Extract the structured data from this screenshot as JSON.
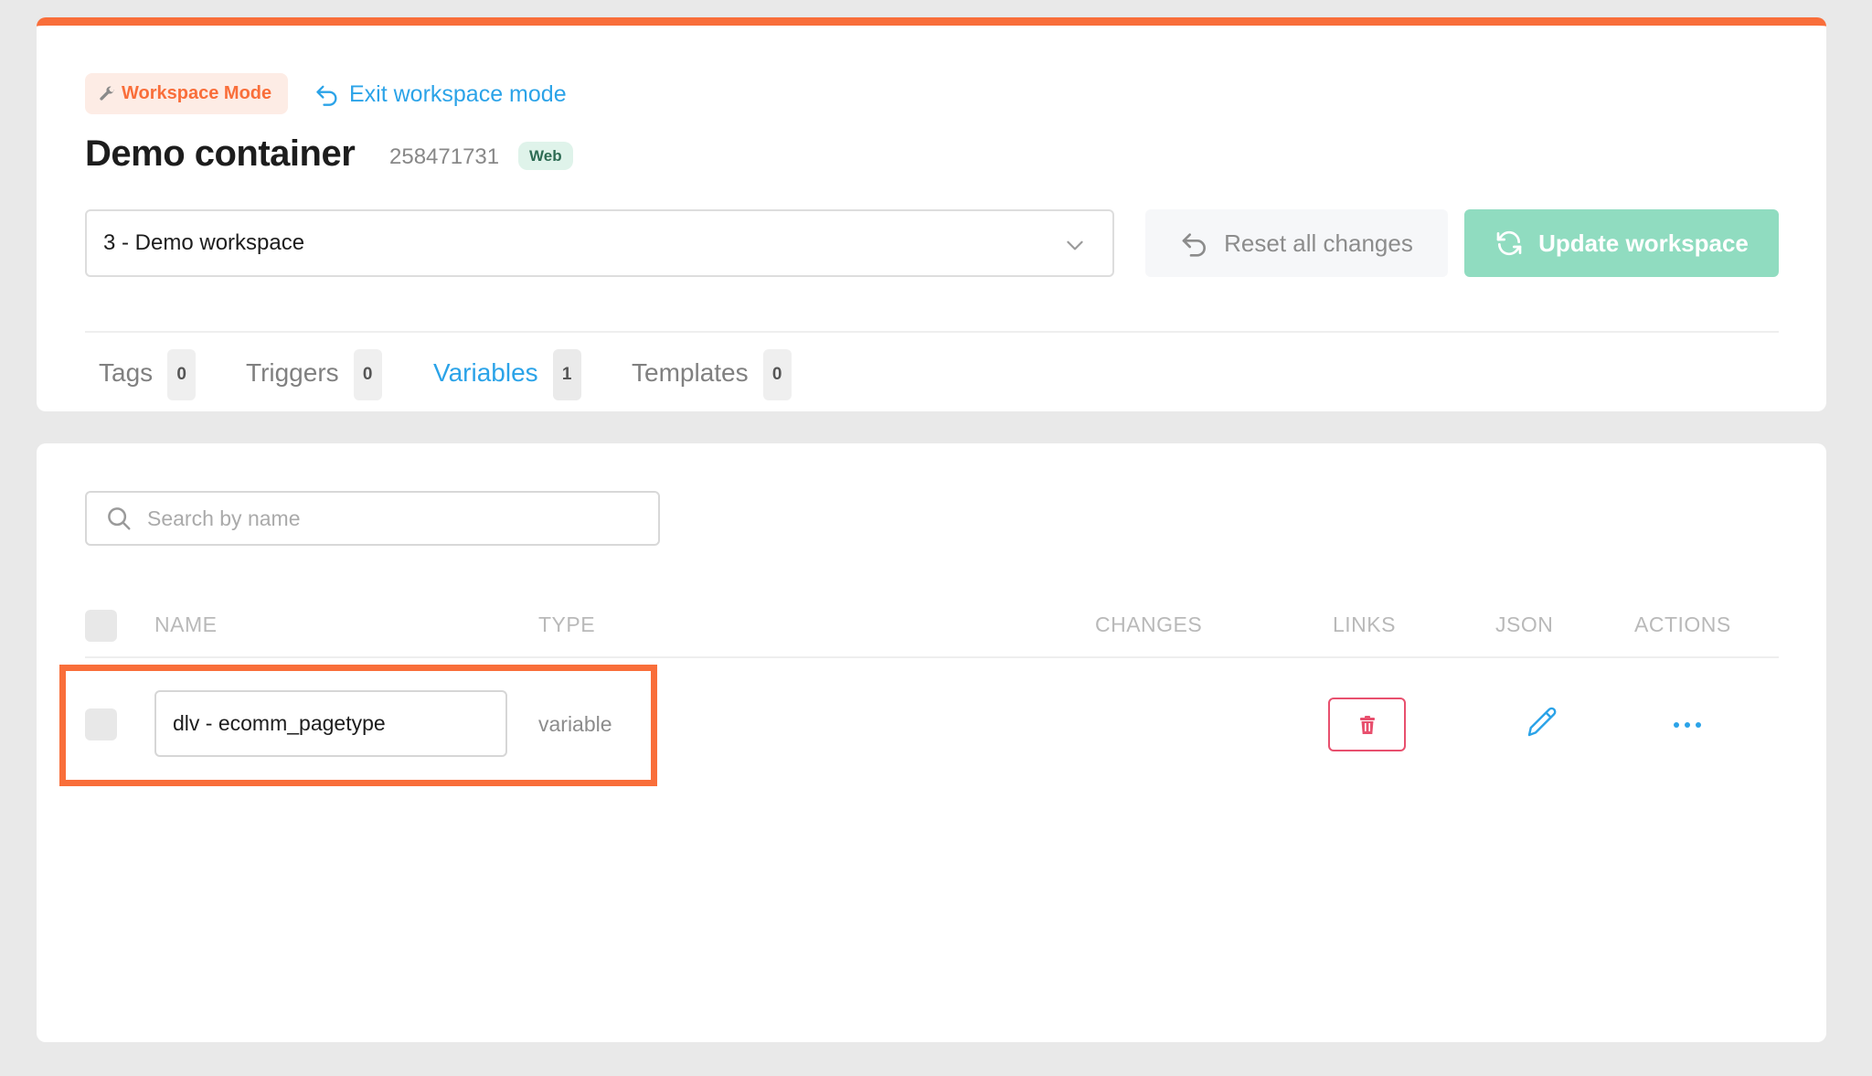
{
  "header": {
    "mode_badge": "Workspace Mode",
    "exit_link": "Exit workspace mode",
    "title": "Demo container",
    "container_id": "258471731",
    "platform": "Web"
  },
  "workspace_selector": {
    "selected": "3 - Demo workspace"
  },
  "buttons": {
    "reset": "Reset all changes",
    "update": "Update workspace"
  },
  "tabs": [
    {
      "label": "Tags",
      "count": "0"
    },
    {
      "label": "Triggers",
      "count": "0"
    },
    {
      "label": "Variables",
      "count": "1",
      "active": true
    },
    {
      "label": "Templates",
      "count": "0"
    }
  ],
  "search": {
    "placeholder": "Search by name"
  },
  "table": {
    "columns": {
      "name": "NAME",
      "type": "TYPE",
      "changes": "CHANGES",
      "links": "LINKS",
      "json": "JSON",
      "actions": "ACTIONS"
    },
    "rows": [
      {
        "name": "dlv - ecomm_pagetype",
        "type": "variable"
      }
    ]
  },
  "colors": {
    "accent_orange": "#f96e3a",
    "link_blue": "#2ba3e8",
    "update_green": "#90dcc0",
    "delete_red": "#e8506e"
  }
}
